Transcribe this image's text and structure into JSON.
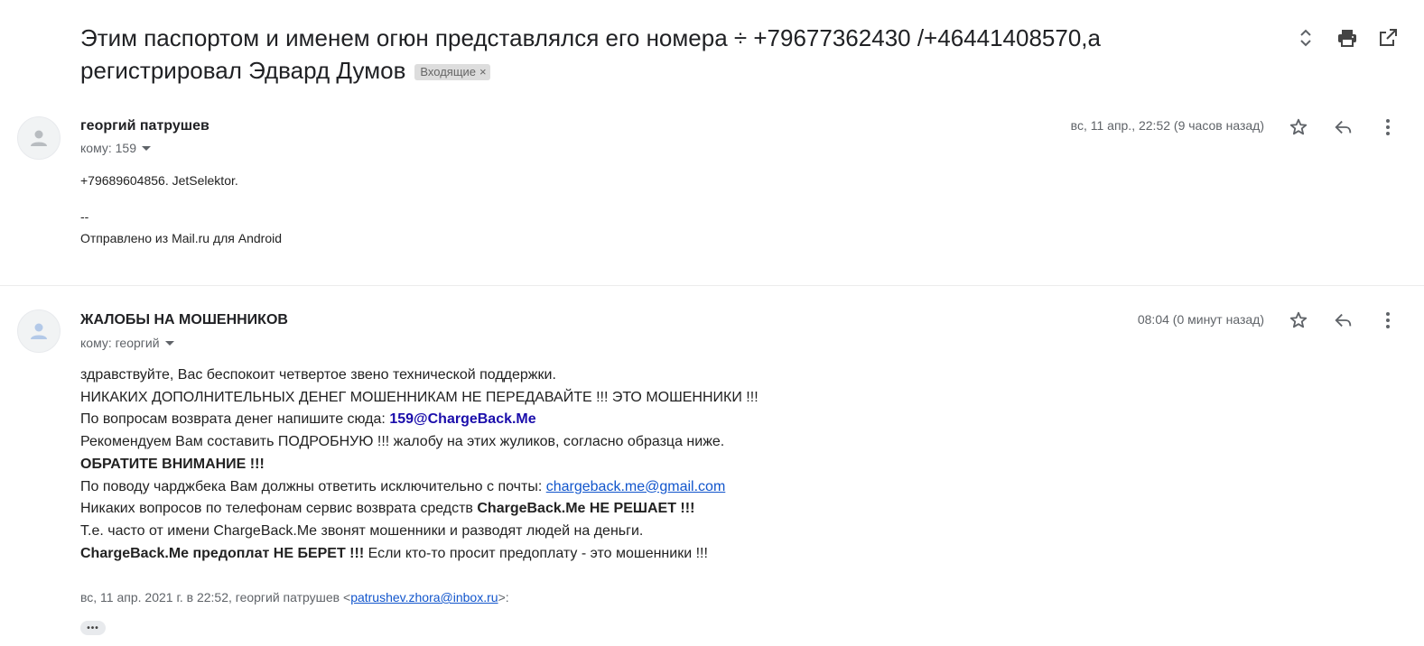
{
  "subject": {
    "line1": "Этим паспортом и именем огюн представлялся его номера ÷ +79677362430 /+46441408570,а",
    "line2": "регистрировал Эдвард Думов",
    "label": "Входящие",
    "label_close": "×"
  },
  "toolbar": {
    "expand_icon": "unfold-icon",
    "print_icon": "print-icon",
    "newwindow_icon": "open-in-new-icon"
  },
  "message1": {
    "sender": "георгий патрушев",
    "to": "кому: 159",
    "date": "вс, 11 апр., 22:52 (9 часов назад)",
    "body": [
      "+79689604856. JetSelektor.",
      "--",
      "Отправлено из Mail.ru для Android"
    ]
  },
  "message2": {
    "sender": "ЖАЛОБЫ НА МОШЕННИКОВ",
    "to": "кому: георгий",
    "date": "08:04 (0 минут назад)",
    "l1": "здравствуйте, Вас беспокоит четвертое звено технической поддержки.",
    "l2": "НИКАКИХ ДОПОЛНИТЕЛЬНЫХ ДЕНЕГ МОШЕННИКАМ НЕ ПЕРЕДАВАЙТЕ !!! ЭТО МОШЕННИКИ !!!",
    "l3_text": "По вопросам возврата денег напишите сюда: ",
    "l3_email": "159@ChargeBack.Me",
    "l4": "Рекомендуем Вам составить ПОДРОБНУЮ !!! жалобу на этих жуликов, согласно образца ниже.",
    "l5": "ОБРАТИТЕ ВНИМАНИЕ !!!",
    "l6_text": "По поводу чарджбека Вам должны ответить исключительно с почты: ",
    "l6_link": "chargeback.me@gmail.com",
    "l7_text": "Никаких вопросов по телефонам сервис возврата средств ",
    "l7_bold": "ChargeBack.Me НЕ РЕШАЕТ !!!",
    "l8": "Т.е. часто от имени ChargeBack.Me звонят мошенники и разводят людей на деньги.",
    "l9_bold": "ChargeBack.Me предоплат НЕ БЕРЕТ !!!",
    "l9_text": " Если кто-то просит предоплату - это мошенники !!!",
    "quote_prefix": "вс, 11 апр. 2021 г. в 22:52, георгий патрушев <",
    "quote_email": "patrushev.zhora@inbox.ru",
    "quote_suffix": ">:",
    "more": "•••"
  },
  "icons": {
    "avatar": "person-icon",
    "star": "star-icon",
    "reply": "reply-icon",
    "more": "more-vert-icon"
  }
}
